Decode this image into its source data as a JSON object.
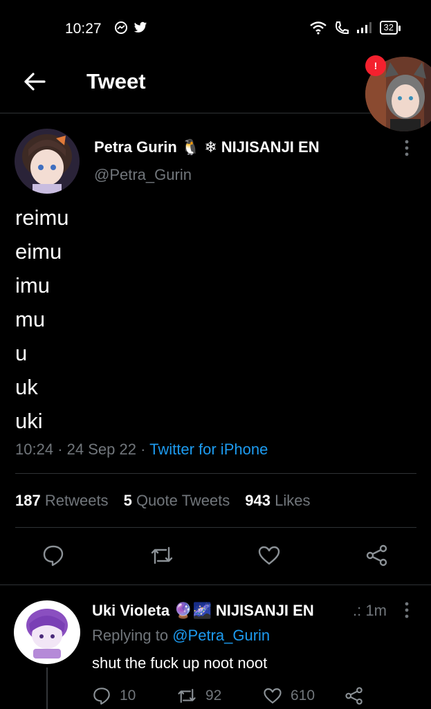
{
  "status_bar": {
    "time": "10:27",
    "battery": "32"
  },
  "header": {
    "title": "Tweet"
  },
  "floating_avatar": {
    "badge": "!"
  },
  "tweet": {
    "display_name": "Petra Gurin",
    "name_emoji": "🐧 ❄",
    "affiliation": "NIJISANJI EN",
    "handle": "@Petra_Gurin",
    "lines": [
      "reimu",
      "eimu",
      "imu",
      "mu",
      "u",
      "uk",
      "uki"
    ],
    "time": "10:24",
    "date": "24 Sep 22",
    "source": "Twitter for iPhone",
    "stats": {
      "retweets_count": "187",
      "retweets_label": "Retweets",
      "quotes_count": "5",
      "quotes_label": "Quote Tweets",
      "likes_count": "943",
      "likes_label": "Likes"
    }
  },
  "reply": {
    "display_name": "Uki Violeta",
    "name_emoji": "🔮🌌",
    "affiliation": "NIJISANJI EN",
    "time": ".: 1m",
    "replying_prefix": "Replying to",
    "replying_to": "@Petra_Gurin",
    "text": "shut the fuck up noot noot",
    "reply_count": "10",
    "retweet_count": "92",
    "like_count": "610"
  },
  "colors": {
    "accent": "#1d9bf0",
    "muted": "#71767b",
    "badge": "#f4212e",
    "divider": "#2f3336"
  },
  "icons": [
    "back-arrow-icon",
    "messenger-icon",
    "twitter-icon",
    "wifi-icon",
    "call-icon",
    "signal-icon",
    "reply-icon",
    "retweet-icon",
    "like-icon",
    "share-icon",
    "more-icon"
  ]
}
